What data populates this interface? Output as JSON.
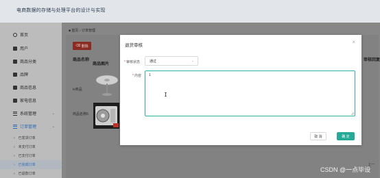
{
  "header": {
    "title": "电商数据的存储与处理平台的设计与实现"
  },
  "sidebar": {
    "items": [
      {
        "label": "首页",
        "icon": "home-circle-icon"
      },
      {
        "label": "用户",
        "icon": "user-icon"
      },
      {
        "label": "商品分类",
        "icon": "category-icon"
      },
      {
        "label": "品牌",
        "icon": "brand-icon"
      },
      {
        "label": "商品信息",
        "icon": "goods-icon"
      },
      {
        "label": "家电信息",
        "icon": "appliance-icon"
      },
      {
        "label": "系统管理",
        "icon": "menu-bars-icon"
      },
      {
        "label": "订单管理",
        "icon": "menu-bars-icon"
      }
    ],
    "sub_items": [
      {
        "label": "已发货订单"
      },
      {
        "label": "未支付订单"
      },
      {
        "label": "已支付订单"
      },
      {
        "label": "已完成订单"
      },
      {
        "label": "已退款订单"
      }
    ],
    "chevron": "⌄"
  },
  "breadcrumb": {
    "home": "首页",
    "sep": "›",
    "current": "订单管理"
  },
  "toolbar": {
    "delete_label": "删除"
  },
  "table": {
    "headers": [
      "商品名称",
      "商品图片",
      "审核回复"
    ],
    "rows": [
      {
        "name": "iv商品"
      },
      {
        "name": "商品名称6"
      }
    ]
  },
  "pager": {
    "prev": "上一"
  },
  "dialog": {
    "title": "退货审核",
    "close": "×",
    "status_label": "审核状态",
    "status_value": "通过",
    "content_label": "内容",
    "content_value": "1",
    "cancel_label": "取 消",
    "ok_label": "确 定",
    "required_mark": "*"
  },
  "watermark": "CSDN @一点毕设",
  "colors": {
    "primary": "#26a996",
    "focus_border": "#2bb3a3",
    "danger": "#8a2c24",
    "active_menu": "#2b6ab7",
    "overlay": "#7a7a7a"
  }
}
